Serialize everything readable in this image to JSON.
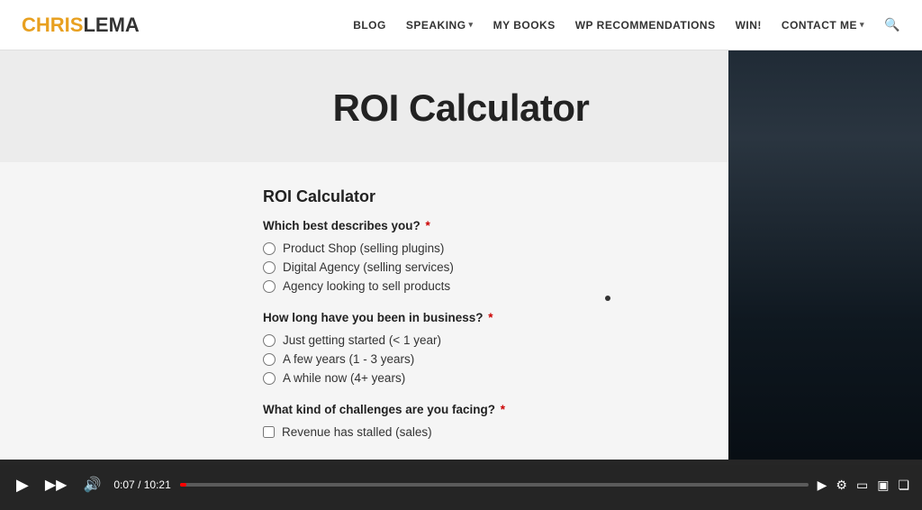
{
  "brand": {
    "chris": "CHRIS",
    "lema": "LEMA"
  },
  "nav": {
    "links": [
      {
        "label": "BLOG",
        "dropdown": false
      },
      {
        "label": "SPEAKING",
        "dropdown": true
      },
      {
        "label": "MY BOOKS",
        "dropdown": false
      },
      {
        "label": "WP RECOMMENDATIONS",
        "dropdown": false
      },
      {
        "label": "WIN!",
        "dropdown": false
      },
      {
        "label": "CONTACT ME",
        "dropdown": true
      }
    ]
  },
  "hero": {
    "title": "ROI Calculator"
  },
  "form": {
    "title": "ROI Calculator",
    "question1": {
      "label": "Which best describes you?",
      "required": true,
      "options": [
        "Product Shop (selling plugins)",
        "Digital Agency (selling services)",
        "Agency looking to sell products"
      ]
    },
    "question2": {
      "label": "How long have you been in business?",
      "required": true,
      "options": [
        "Just getting started (< 1 year)",
        "A few years (1 - 3 years)",
        "A while now (4+ years)"
      ]
    },
    "question3": {
      "label": "What kind of challenges are you facing?",
      "required": true,
      "options": [
        "Revenue has stalled (sales)"
      ]
    }
  },
  "video": {
    "time_current": "0:07",
    "time_total": "10:21",
    "progress_percent": 1.1
  }
}
